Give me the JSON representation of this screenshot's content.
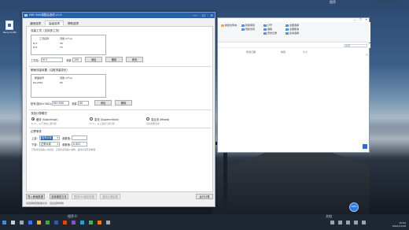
{
  "desktop": {
    "icon_label": "Recycle Bin",
    "top_label": "程序"
  },
  "explorer": {
    "ribbon": [
      [
        "新建项目",
        "轻松访问"
      ],
      [
        "打开",
        "编辑",
        "历史记录"
      ],
      [
        "全部选择",
        "全部取消",
        "反向选择"
      ]
    ],
    "ribbon_extra": "新建文件夹",
    "search_placeholder": "搜索\"",
    "columns": [
      "修改日期",
      "类型",
      "大小"
    ]
  },
  "app": {
    "title": "HKC RAS调整及选项 v1.0",
    "tabs": [
      "通用选项",
      "高级选项",
      "帮助选项"
    ],
    "active_tab": 1,
    "section1": {
      "title": "流量工况（支持多工况）",
      "headers": [
        "工况名称",
        "流量 (m³/s)"
      ],
      "rows": [
        [
          "M 1",
          "50"
        ],
        [
          "M 2",
          "75"
        ]
      ],
      "input_label": "工况名:",
      "input_value": "M 3",
      "flow_label": "流量:",
      "flow_value": "100",
      "add": "添加",
      "delete": "删除",
      "modify": "修改"
    },
    "section2": {
      "title": "断面流量设置（沿程流量变化）",
      "headers": [
        "断面桩号",
        "流量 (m³/s)"
      ],
      "rows": [
        [
          "K0+500",
          "50"
        ]
      ],
      "pos_label": "桩号(如K0+500):",
      "pos_value": "K0+500",
      "flow_label": "流量:",
      "flow_value": "50",
      "add": "添加",
      "delete": "删除"
    },
    "section3": {
      "title": "流态计算模式",
      "options": [
        "缓流 (Subcritical)",
        "急流 (Supercritical)",
        "混合流 (Mixed)"
      ],
      "selected": 0,
      "hints": [
        "Fr<1，从下游向上游计算",
        "Fr>1，从上游向下游计算",
        "自动判断流态"
      ]
    },
    "section4": {
      "title": "边界条件",
      "up_label": "上游:",
      "up_value": "临界水深",
      "up_param_label": "参数值:",
      "up_param_value": "",
      "down_label": "下游:",
      "down_value": "正常水深",
      "down_param_label": "参数值:",
      "down_param_value": "0.001",
      "hint": "已知水位需输入水位值，正常水深需输入坡降，临界水深无需参数"
    },
    "buttons": {
      "import": "导入断面数据",
      "select_file": "选择模型文件",
      "preview": "预览RAS模型参数",
      "export": "更新计算结果",
      "run": "运行计算"
    },
    "status": "请选择模型数据文件，然后选择参数"
  },
  "taskbar": {
    "left_label": "程序 II",
    "right_label": "文档",
    "time": "15:02",
    "date": "2024/11/26",
    "float_label": "100%"
  }
}
